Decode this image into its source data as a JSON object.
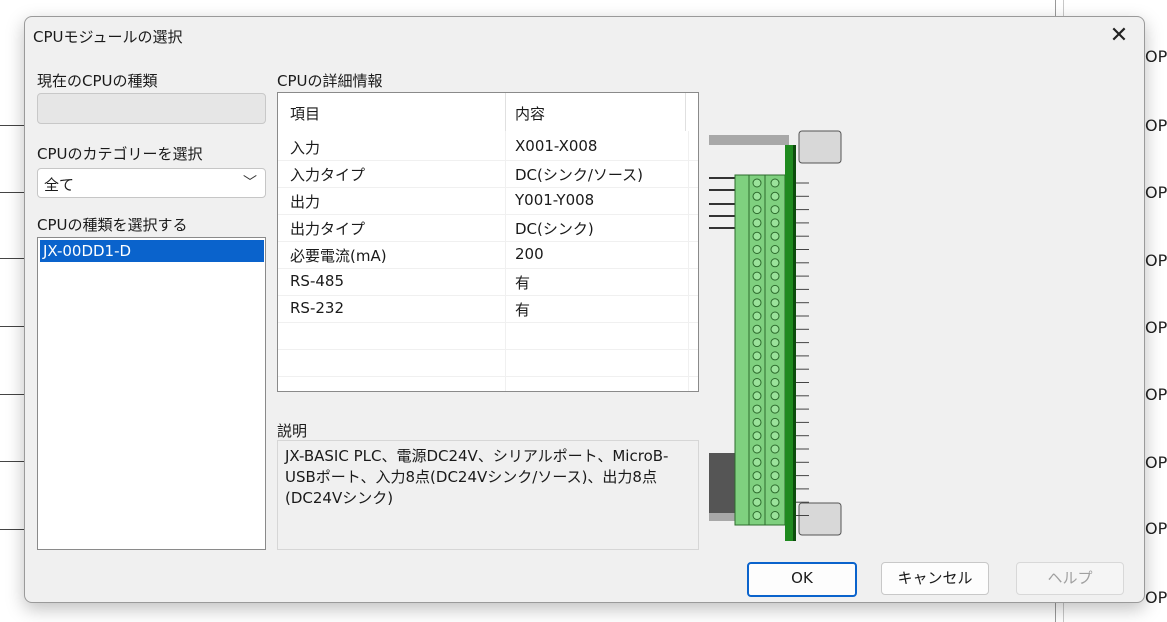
{
  "background": {
    "right_labels": [
      "OP",
      "OP",
      "OP",
      "OP",
      "OP",
      "OP",
      "OP",
      "OP",
      "OP",
      "OP"
    ]
  },
  "dialog": {
    "title": "CPUモジュールの選択",
    "close_icon": "close-icon",
    "current_cpu": {
      "label": "現在のCPUの種類",
      "value": ""
    },
    "category": {
      "label": "CPUのカテゴリーを選択",
      "selected": "全て"
    },
    "cpu_type": {
      "label": "CPUの種類を選択する",
      "items": [
        "JX-00DD1-D"
      ],
      "selected_index": 0
    },
    "details": {
      "label": "CPUの詳細情報",
      "columns": [
        "項目",
        "内容"
      ],
      "rows": [
        [
          "入力",
          "X001-X008"
        ],
        [
          "入力タイプ",
          "DC(シンク/ソース)"
        ],
        [
          "出力",
          "Y001-Y008"
        ],
        [
          "出力タイプ",
          "DC(シンク)"
        ],
        [
          "必要電流(mA)",
          "200"
        ],
        [
          "RS-485",
          "有"
        ],
        [
          "RS-232",
          "有"
        ]
      ]
    },
    "description": {
      "label": "説明",
      "text": "JX-BASIC PLC、電源DC24V、シリアルポート、MicroB-USBポート、入力8点(DC24Vシンク/ソース)、出力8点(DC24Vシンク)"
    },
    "buttons": {
      "ok": "OK",
      "cancel": "キャンセル",
      "help": "ヘルプ"
    },
    "colors": {
      "selection": "#0a63cc",
      "terminal_green": "#7fd07f",
      "rail_green": "#1f8a1f"
    }
  }
}
